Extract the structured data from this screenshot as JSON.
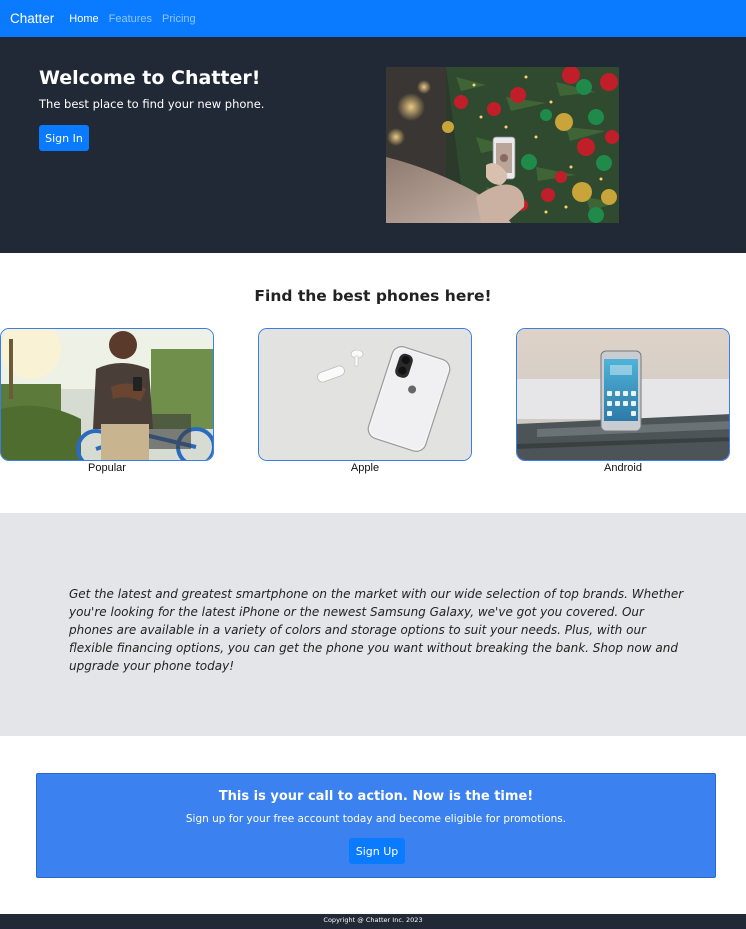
{
  "navbar": {
    "brand": "Chatter",
    "links": [
      "Home",
      "Features",
      "Pricing"
    ]
  },
  "hero": {
    "title": "Welcome to Chatter!",
    "subtitle": "The best place to find your new phone.",
    "button": "Sign In"
  },
  "phones": {
    "title": "Find the best phones here!",
    "cards": [
      "Popular",
      "Apple",
      "Android"
    ]
  },
  "promo": {
    "text": "Get the latest and greatest smartphone on the market with our wide selection of top brands. Whether you're looking for the latest iPhone or the newest Samsung Galaxy, we've got you covered. Our phones are available in a variety of colors and storage options to suit your needs. Plus, with our flexible financing options, you can get the phone you want without breaking the bank. Shop now and upgrade your phone today!"
  },
  "cta": {
    "title": "This is your call to action. Now is the time!",
    "subtitle": "Sign up for your free account today and become eligible for promotions.",
    "button": "Sign Up"
  },
  "footer": {
    "text": "Copyright @ Chatter Inc. 2023"
  },
  "colors": {
    "primary": "#0a7bff",
    "dark": "#212936",
    "gray": "#e4e5e8",
    "cta": "#3b82f0"
  }
}
